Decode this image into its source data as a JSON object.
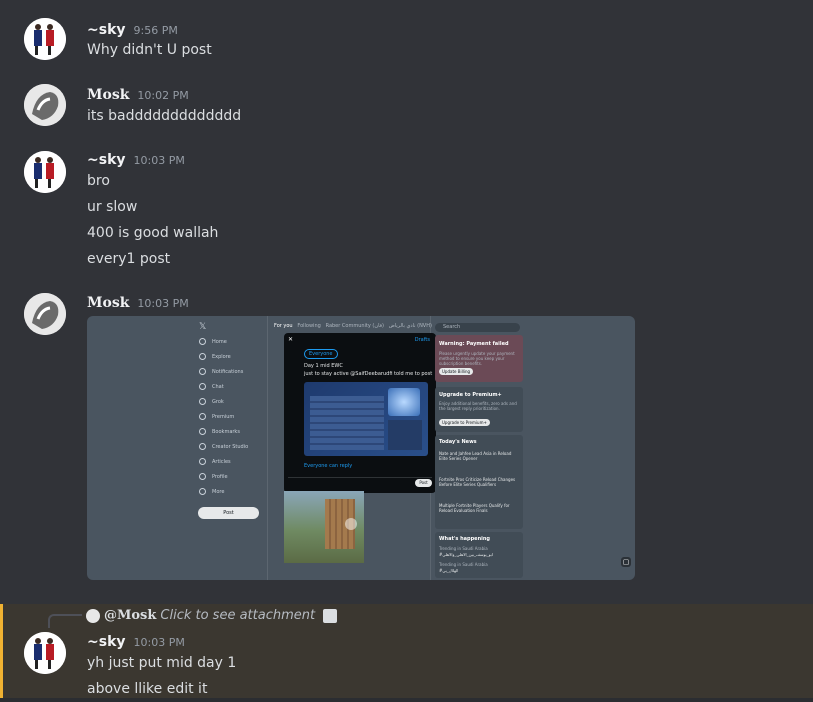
{
  "messages": [
    {
      "user": "~sky",
      "time": "9:56 PM",
      "lines": [
        "Why didn't U post"
      ]
    },
    {
      "user": "Mosk",
      "time": "10:02 PM",
      "lines": [
        "its baddddddddddddd"
      ]
    },
    {
      "user": "~sky",
      "time": "10:03 PM",
      "lines": [
        "bro",
        "ur slow",
        "400 is good wallah",
        "every1 post"
      ]
    },
    {
      "user": "Mosk",
      "time": "10:03 PM",
      "lines": []
    },
    {
      "user": "~sky",
      "time": "10:03 PM",
      "lines": [
        "yh just put mid day 1",
        "above llike edit it"
      ]
    }
  ],
  "reply": {
    "user": "@Mosk",
    "text": "Click to see attachment"
  },
  "attachment": {
    "nav": [
      "Home",
      "Explore",
      "Notifications",
      "Chat",
      "Grok",
      "Premium",
      "Bookmarks",
      "Creator Studio",
      "Articles",
      "Profile",
      "More"
    ],
    "post_button": "Post",
    "tabs": [
      "For you",
      "Following",
      "Raber Community (فان)",
      "نادي بالرياض (NVH)"
    ],
    "search_placeholder": "Search",
    "modal": {
      "audience": "Everyone",
      "drafts": "Drafts",
      "text1": "Day 1 mid EWC",
      "text2": "just to stay active @SaifDeebarudfi told me to post",
      "reply_setting": "Everyone can reply",
      "submit": "Post"
    },
    "warning": {
      "title": "Warning: Payment failed",
      "body": "Please urgently update your payment method to ensure you keep your subscription benefits.",
      "button": "Update Billing"
    },
    "premium": {
      "title": "Upgrade to Premium+",
      "body": "Enjoy additional benefits, zero ads and the largest reply prioritization.",
      "button": "Upgrade to Premium+"
    },
    "news": {
      "title": "Today's News",
      "items": [
        "Nate and Jahfee Lead Asia in Reload Elite Series Opener",
        "Fortnite Pros Criticize Reload Changes Before Elite Series Qualifiers",
        "Multiple Fortnite Players Qualify for Reload Evaluation Finals"
      ]
    },
    "happening": {
      "title": "What's happening",
      "trend_label": "Trending in Saudi Arabia",
      "trend1": "#ابو_يوسف_بين_الاهلي_والاهلي",
      "trend2": "#الهلال_بي"
    }
  }
}
